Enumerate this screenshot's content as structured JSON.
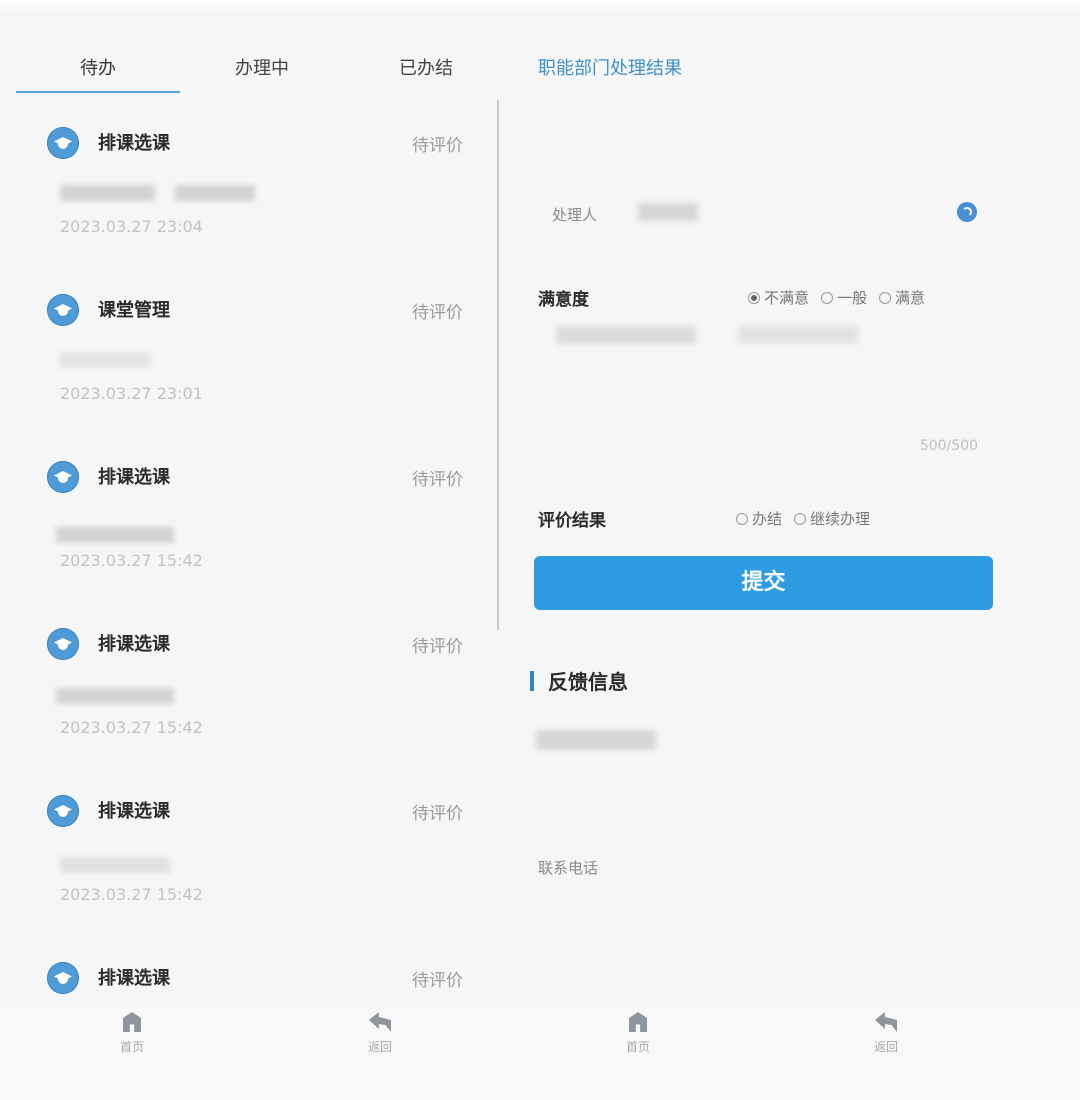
{
  "tabs": {
    "todo": "待办",
    "in_progress": "办理中",
    "done": "已办结",
    "dept_result": "职能部门处理结果"
  },
  "list": {
    "items": [
      {
        "title": "排课选课",
        "status": "待评价",
        "date": "2023.03.27 23:04"
      },
      {
        "title": "课堂管理",
        "status": "待评价",
        "date": "2023.03.27 23:01"
      },
      {
        "title": "排课选课",
        "status": "待评价",
        "date": "2023.03.27 15:42"
      },
      {
        "title": "排课选课",
        "status": "待评价",
        "date": "2023.03.27 15:42"
      },
      {
        "title": "排课选课",
        "status": "待评价",
        "date": "2023.03.27 15:42"
      },
      {
        "title": "排课选课",
        "status": "待评价"
      }
    ]
  },
  "form": {
    "handler_label": "处理人",
    "satisfaction_label": "满意度",
    "satisfaction_options": {
      "unsatisfied": "不满意",
      "average": "一般",
      "satisfied": "满意"
    },
    "satisfaction_selected": "unsatisfied",
    "char_counter": "500/500",
    "result_label": "评价结果",
    "result_options": {
      "closed": "办结",
      "continue": "继续办理"
    },
    "submit_label": "提交"
  },
  "feedback": {
    "section_title": "反馈信息",
    "phone_label": "联系电话"
  },
  "bottom_nav": {
    "left_home": "首页",
    "left_back": "返回",
    "right_home": "首页",
    "right_back": "返回"
  },
  "colors": {
    "accent": "#2f9be2",
    "tab_link": "#3d8fce",
    "icon_blue": "#4e9bd8"
  }
}
